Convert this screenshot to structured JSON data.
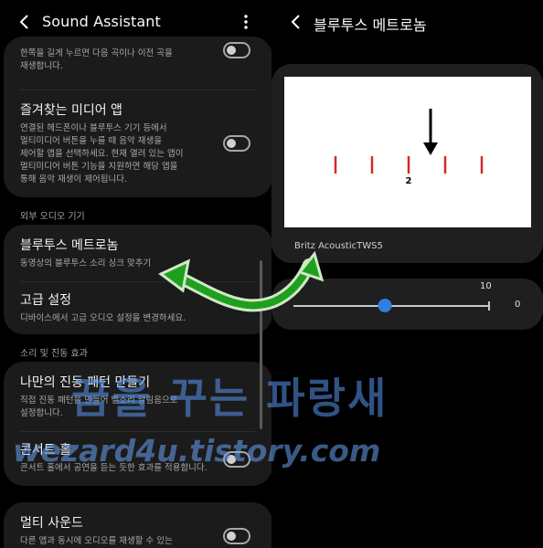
{
  "left_screen": {
    "title": "Sound Assistant",
    "icons": {
      "back": "chevron-left-icon",
      "more": "more-vertical-icon"
    },
    "partial_item_desc": "한쪽을 길게 누르면 다음 곡이나 이전 곡을\n재생합니다.",
    "favorite_media_app": {
      "title": "즐겨찾는 미디어 앱",
      "desc": "연결된 헤드폰이나 블루투스 기기 등에서\n멀티미디어 버튼을 누를 때 음악 재생을\n제어할 앱을 선택하세요. 현재 열려 있는 앱이\n멀티미디어 버튼 기능을 지원하면 해당 앱을\n통해 음악 재생이 제어됩니다.",
      "enabled": false
    },
    "section_external": "외부 오디오 기기",
    "bluetooth_metronome": {
      "title": "블루투스 메트로놈",
      "desc": "동영상의 블루투스 소리 싱크 맞추기"
    },
    "advanced": {
      "title": "고급 설정",
      "desc": "디바이스에서 고급 오디오 설정을 변경하세요."
    },
    "section_sound": "소리 및 진동 효과",
    "my_vibration": {
      "title": "나만의 진동 패턴 만들기",
      "desc": "직접 진동 패턴을 만들어 벨소리 알림음으로\n설정합니다."
    },
    "concert_hall": {
      "title": "콘서트 홀",
      "desc": "콘서트 홀에서 공연을 듣는 듯한 효과를 적용합니다.",
      "enabled": false
    },
    "multi_sound": {
      "title": "멀티 사운드",
      "desc": "다른 앱과 동시에 오디오를 재생할 수 있는",
      "enabled": false
    }
  },
  "right_screen": {
    "title": "블루투스 메트로놈",
    "icons": {
      "back": "chevron-left-icon"
    },
    "metronome": {
      "marker_label": "2",
      "tick_count": 5,
      "arrow_tick_index": 2
    },
    "device_name": "Britz AcousticTWS5",
    "slider": {
      "max_label": "10",
      "value_label": "0",
      "fraction": 0.47
    }
  },
  "watermark": {
    "korean": "꿈을 꾸는 파랑새",
    "url": "wezard4u.tistory.com"
  },
  "colors": {
    "background": "#000000",
    "card": "#1b1b1b",
    "accent_blue": "#2f7fe0",
    "tick_red": "#d62828",
    "annotation_green": "#1f9f1f"
  }
}
